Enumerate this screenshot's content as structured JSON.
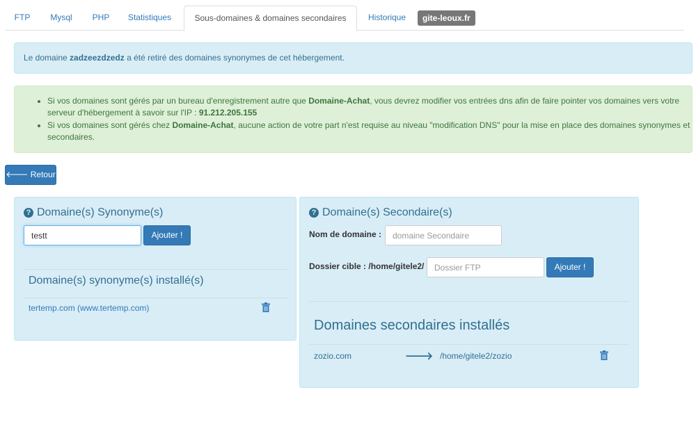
{
  "tabs": [
    {
      "label": "FTP"
    },
    {
      "label": "Mysql"
    },
    {
      "label": "PHP"
    },
    {
      "label": "Statistiques"
    },
    {
      "label": "Sous-domaines & domaines secondaires"
    },
    {
      "label": "Historique"
    }
  ],
  "domain_badge": "gite-leoux.fr",
  "info_alert": {
    "prefix": "Le domaine ",
    "domain": "zadzeezdzedz",
    "suffix": " a été retiré des domaines synonymes de cet hébergement."
  },
  "dns_alert": {
    "item1_a": "Si vos domaines sont gérés par un bureau d'enregistrement autre que ",
    "item1_brand": "Domaine-Achat",
    "item1_b": ", vous devrez modifier vos entrées dns afin de faire pointer vos domaines vers votre serveur d'hébergement à savoir sur l'IP : ",
    "item1_ip": "91.212.205.155",
    "item2_a": "Si vos domaines sont gérés chez ",
    "item2_brand": "Domaine-Achat",
    "item2_b": ", aucune action de votre part n'est requise au niveau \"modification DNS\" pour la mise en place des domaines synonymes et secondaires."
  },
  "back_button": "Retour",
  "synonyms": {
    "title": "Domaine(s) Synonyme(s)",
    "input_value": "testt",
    "add_button": "Ajouter !",
    "installed_title": "Domaine(s) synonyme(s) installé(s)",
    "items": [
      {
        "label": "tertemp.com (www.tertemp.com)"
      }
    ]
  },
  "secondary": {
    "title": "Domaine(s) Secondaire(s)",
    "domain_label": "Nom de domaine :",
    "domain_placeholder": "domaine Secondaire",
    "target_label": "Dossier cible : /home/gitele2/",
    "target_placeholder": "Dossier FTP",
    "add_button": "Ajouter !",
    "installed_title": "Domaines secondaires installés",
    "items": [
      {
        "domain": "zozio.com",
        "path": "/home/gitele2/zozio"
      }
    ]
  }
}
